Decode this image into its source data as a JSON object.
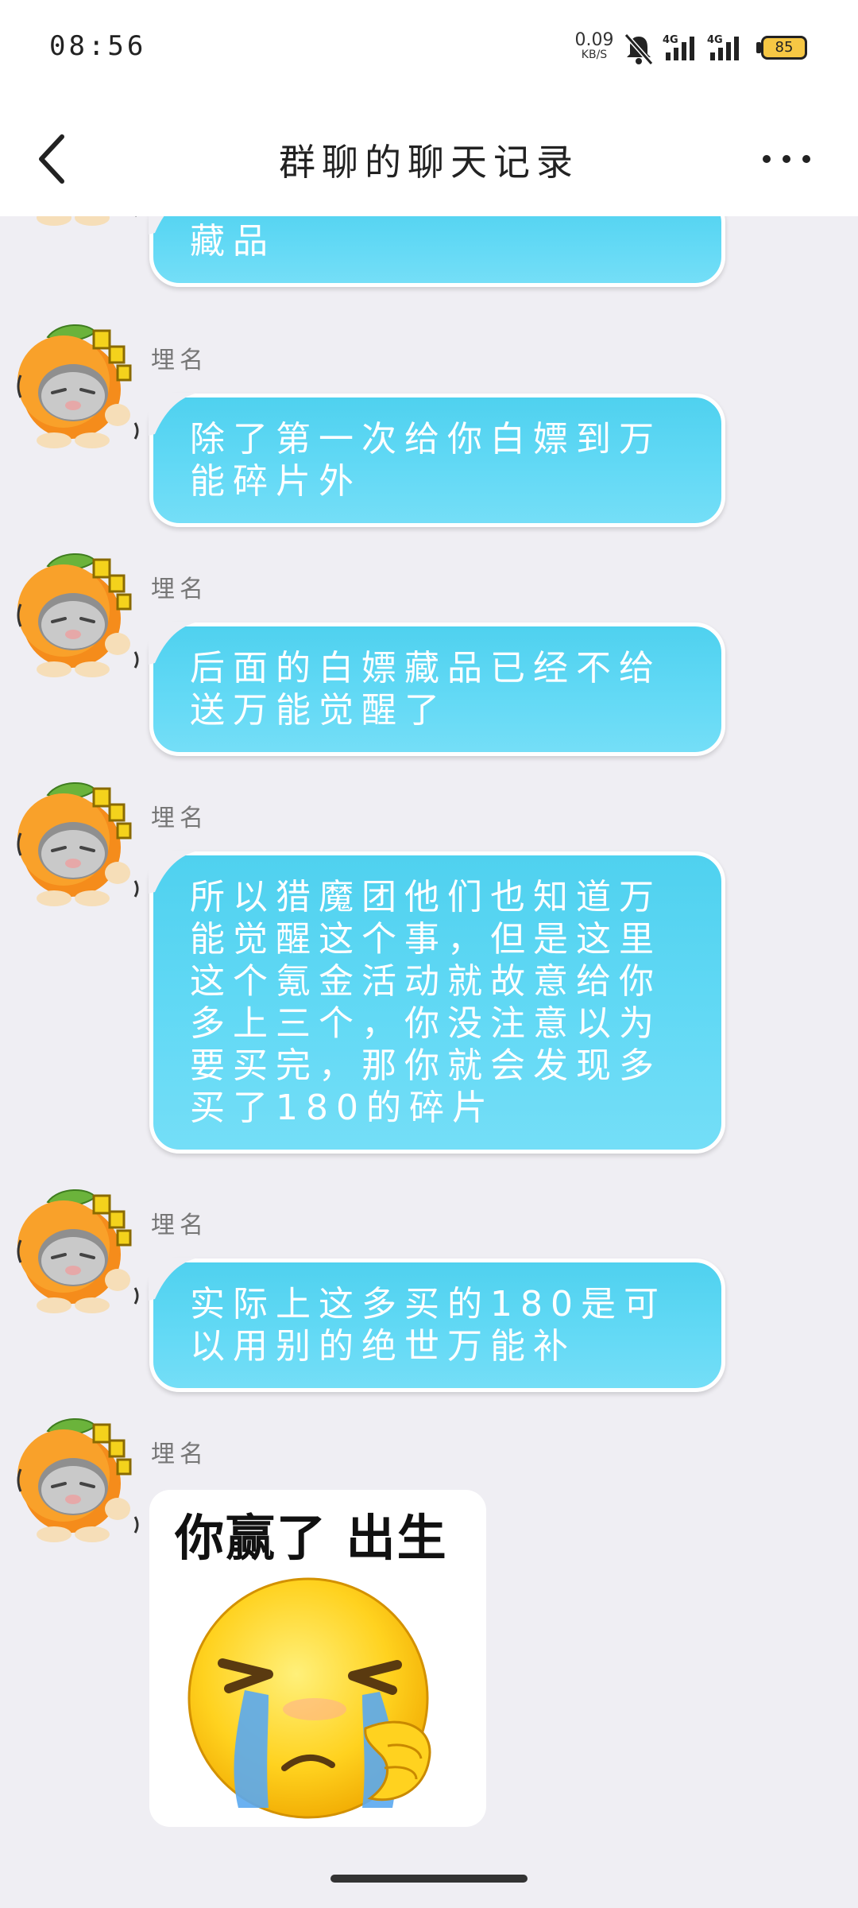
{
  "status_bar": {
    "time": "08:56",
    "net_speed_value": "0.09",
    "net_speed_unit": "KB/S",
    "signal_1_label": "4G",
    "signal_2_label": "4G",
    "battery_level": "85"
  },
  "header": {
    "title": "群聊的聊天记录",
    "back_icon": "chevron-left-icon",
    "more_icon": "more-horizontal-icon"
  },
  "messages": [
    {
      "sender": "",
      "text": "藏品"
    },
    {
      "sender": "埋名",
      "text": "除了第一次给你白嫖到万能碎片外"
    },
    {
      "sender": "埋名",
      "text": "后面的白嫖藏品已经不给送万能觉醒了"
    },
    {
      "sender": "埋名",
      "text": "所以猎魔团他们也知道万能觉醒这个事，但是这里这个氪金活动就故意给你多上三个，你没注意以为要买完，那你就会发现多买了180的碎片"
    },
    {
      "sender": "埋名",
      "text": "实际上这多买的180是可以用别的绝世万能补"
    },
    {
      "sender": "埋名",
      "sticker_text": "你赢了 出生"
    }
  ],
  "colors": {
    "bubble": "#5bd6f3",
    "background": "#efeef3",
    "header": "#ffffff"
  }
}
